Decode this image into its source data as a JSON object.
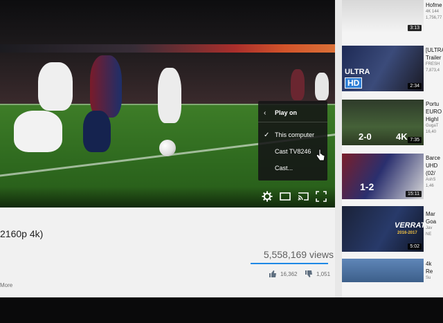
{
  "player": {
    "play_on_menu": {
      "header": "Play on",
      "options": [
        {
          "label": "This computer",
          "selected": true
        },
        {
          "label": "Cast TV8246",
          "selected": false
        },
        {
          "label": "Cast...",
          "selected": false
        }
      ]
    },
    "controls": [
      "gear-icon",
      "miniplayer-icon",
      "cast-icon",
      "fullscreen-icon"
    ]
  },
  "video": {
    "title_fragment": "2160p 4k)",
    "views": "5,558,169 views",
    "likes": "16,362",
    "dislikes": "1,051",
    "show_more": "More"
  },
  "sidebar": {
    "items": [
      {
        "duration": "3:13",
        "title_lines": [
          "Hofme"
        ],
        "meta_lines": [
          "4K 144",
          "1,756,77"
        ]
      },
      {
        "duration": "2:34",
        "overlay": [
          "ULTRA",
          "HD"
        ],
        "title_lines": [
          "[ULTRA",
          "Trailer"
        ],
        "meta_lines": [
          "FRESH",
          "7,873,4"
        ]
      },
      {
        "duration": "7:35",
        "overlay": [
          "2-0",
          "4K"
        ],
        "title_lines": [
          "Portu",
          "EURO",
          "Highl"
        ],
        "meta_lines": [
          "GugaT",
          "16,40"
        ]
      },
      {
        "duration": "15:11",
        "overlay": [
          "1-2"
        ],
        "title_lines": [
          "Barce",
          "UHD",
          "(02/"
        ],
        "meta_lines": [
          "AshS",
          "1,46"
        ]
      },
      {
        "duration": "5:02",
        "overlay": [
          "VERRATTI",
          "2016-2017"
        ],
        "title_lines": [
          "Mar",
          "Goa"
        ],
        "meta_lines": [
          "Jav",
          "NE"
        ]
      },
      {
        "duration": "",
        "title_lines": [
          "4k",
          "Re"
        ],
        "meta_lines": [
          "Su"
        ]
      }
    ]
  },
  "colors": {
    "accent_blue": "#1e88e5",
    "menu_bg": "#141416",
    "duration_bg": "#000000"
  }
}
